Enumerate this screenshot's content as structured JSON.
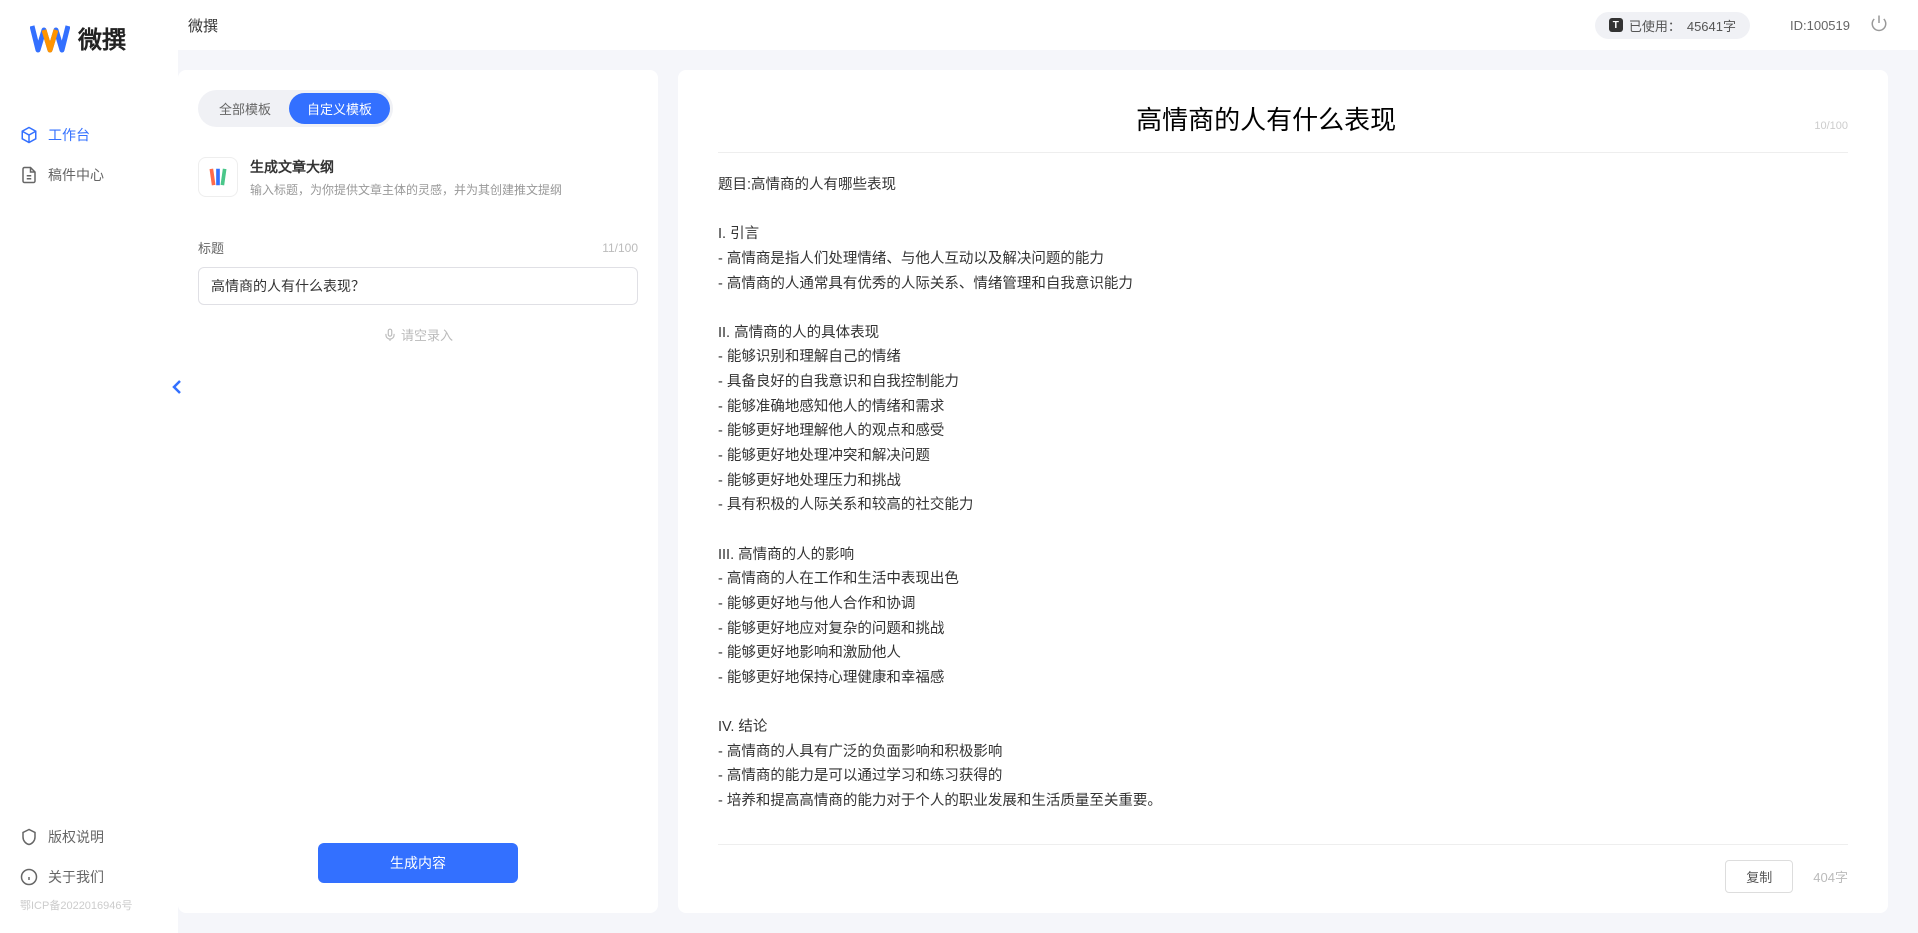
{
  "logo": {
    "text": "微撰"
  },
  "sidebar": {
    "nav": [
      {
        "label": "工作台",
        "active": true
      },
      {
        "label": "稿件中心",
        "active": false
      }
    ],
    "footer": [
      {
        "label": "版权说明"
      },
      {
        "label": "关于我们"
      }
    ],
    "icp": "鄂ICP备2022016946号"
  },
  "topbar": {
    "title": "微撰",
    "usage_label": "已使用：",
    "usage_value": "45641字",
    "user_id": "ID:100519"
  },
  "left": {
    "tabs": [
      {
        "label": "全部模板",
        "active": false
      },
      {
        "label": "自定义模板",
        "active": true
      }
    ],
    "template": {
      "title": "生成文章大纲",
      "desc": "输入标题，为你提供文章主体的灵感，并为其创建推文提纲"
    },
    "form": {
      "label": "标题",
      "count": "11/100",
      "value": "高情商的人有什么表现？",
      "voice": "请空录入"
    },
    "generate": "生成内容"
  },
  "right": {
    "title": "高情商的人有什么表现",
    "title_count": "10/100",
    "body": "题目:高情商的人有哪些表现\n\nI. 引言\n- 高情商是指人们处理情绪、与他人互动以及解决问题的能力\n- 高情商的人通常具有优秀的人际关系、情绪管理和自我意识能力\n\nII. 高情商的人的具体表现\n- 能够识别和理解自己的情绪\n- 具备良好的自我意识和自我控制能力\n- 能够准确地感知他人的情绪和需求\n- 能够更好地理解他人的观点和感受\n- 能够更好地处理冲突和解决问题\n- 能够更好地处理压力和挑战\n- 具有积极的人际关系和较高的社交能力\n\nIII. 高情商的人的影响\n- 高情商的人在工作和生活中表现出色\n- 能够更好地与他人合作和协调\n- 能够更好地应对复杂的问题和挑战\n- 能够更好地影响和激励他人\n- 能够更好地保持心理健康和幸福感\n\nIV. 结论\n- 高情商的人具有广泛的负面影响和积极影响\n- 高情商的能力是可以通过学习和练习获得的\n- 培养和提高高情商的能力对于个人的职业发展和生活质量至关重要。",
    "copy": "复制",
    "word_count": "404字"
  }
}
